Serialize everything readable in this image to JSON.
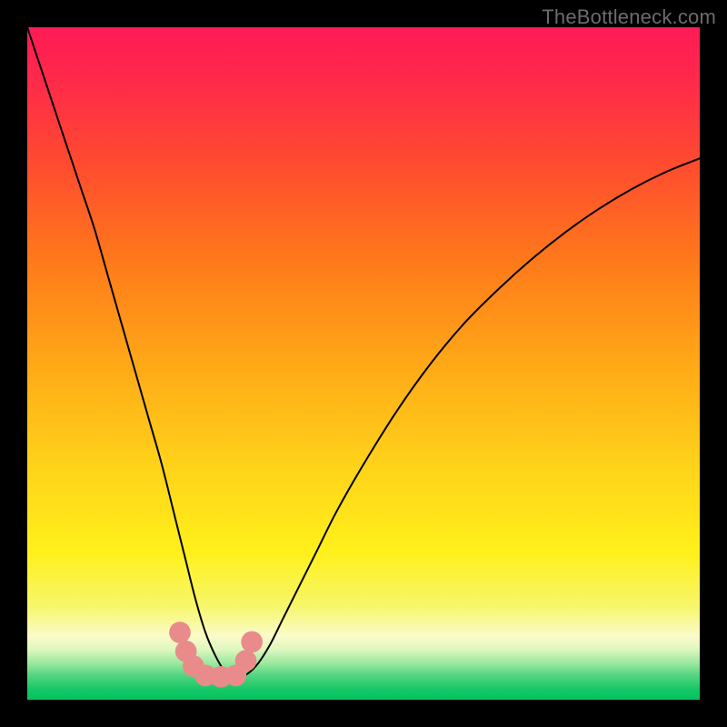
{
  "watermark": "TheBottleneck.com",
  "chart_data": {
    "type": "line",
    "title": "",
    "xlabel": "",
    "ylabel": "",
    "xlim": [
      0,
      100
    ],
    "ylim": [
      0,
      100
    ],
    "background": {
      "type": "vertical-gradient",
      "stops": [
        {
          "offset": 0.0,
          "color": "#ff1a55"
        },
        {
          "offset": 0.08,
          "color": "#ff2a4a"
        },
        {
          "offset": 0.2,
          "color": "#ff4a30"
        },
        {
          "offset": 0.35,
          "color": "#ff7a1a"
        },
        {
          "offset": 0.5,
          "color": "#ffa817"
        },
        {
          "offset": 0.65,
          "color": "#ffd21a"
        },
        {
          "offset": 0.78,
          "color": "#fff01a"
        },
        {
          "offset": 0.86,
          "color": "#f7f66a"
        },
        {
          "offset": 0.905,
          "color": "#fbfbc9"
        },
        {
          "offset": 0.925,
          "color": "#dff7c0"
        },
        {
          "offset": 0.945,
          "color": "#9ee9a0"
        },
        {
          "offset": 0.965,
          "color": "#4fd47f"
        },
        {
          "offset": 0.985,
          "color": "#15c765"
        },
        {
          "offset": 1.0,
          "color": "#06c160"
        }
      ]
    },
    "series": [
      {
        "name": "curve",
        "color": "#000000",
        "width": 2,
        "x": [
          0,
          2,
          4,
          6,
          8,
          10,
          12,
          14,
          16,
          18,
          20,
          22,
          23.5,
          25,
          26.5,
          28,
          29.5,
          30.5,
          32,
          34,
          36,
          38,
          40,
          43,
          46,
          50,
          55,
          60,
          65,
          70,
          75,
          80,
          85,
          90,
          95,
          100
        ],
        "y": [
          100,
          94,
          88,
          82,
          76,
          70,
          63,
          56,
          49,
          42,
          35,
          27,
          21,
          15,
          10,
          6.5,
          4,
          3.2,
          3.4,
          5,
          8,
          12,
          16,
          22,
          28,
          35,
          43,
          50,
          56,
          61,
          65.5,
          69.5,
          73,
          76,
          78.5,
          80.5
        ]
      }
    ],
    "markers": [
      {
        "x": 22.7,
        "y": 10.0,
        "r": 1.6,
        "color": "#e98b8a"
      },
      {
        "x": 23.6,
        "y": 7.2,
        "r": 1.6,
        "color": "#e98b8a"
      },
      {
        "x": 24.7,
        "y": 5.0,
        "r": 1.6,
        "color": "#e98b8a"
      },
      {
        "x": 26.5,
        "y": 3.6,
        "r": 1.6,
        "color": "#e98b8a"
      },
      {
        "x": 28.8,
        "y": 3.4,
        "r": 1.6,
        "color": "#e98b8a"
      },
      {
        "x": 31.0,
        "y": 3.6,
        "r": 1.6,
        "color": "#e98b8a"
      },
      {
        "x": 32.5,
        "y": 5.8,
        "r": 1.6,
        "color": "#e98b8a"
      },
      {
        "x": 33.4,
        "y": 8.6,
        "r": 1.6,
        "color": "#e98b8a"
      }
    ]
  }
}
